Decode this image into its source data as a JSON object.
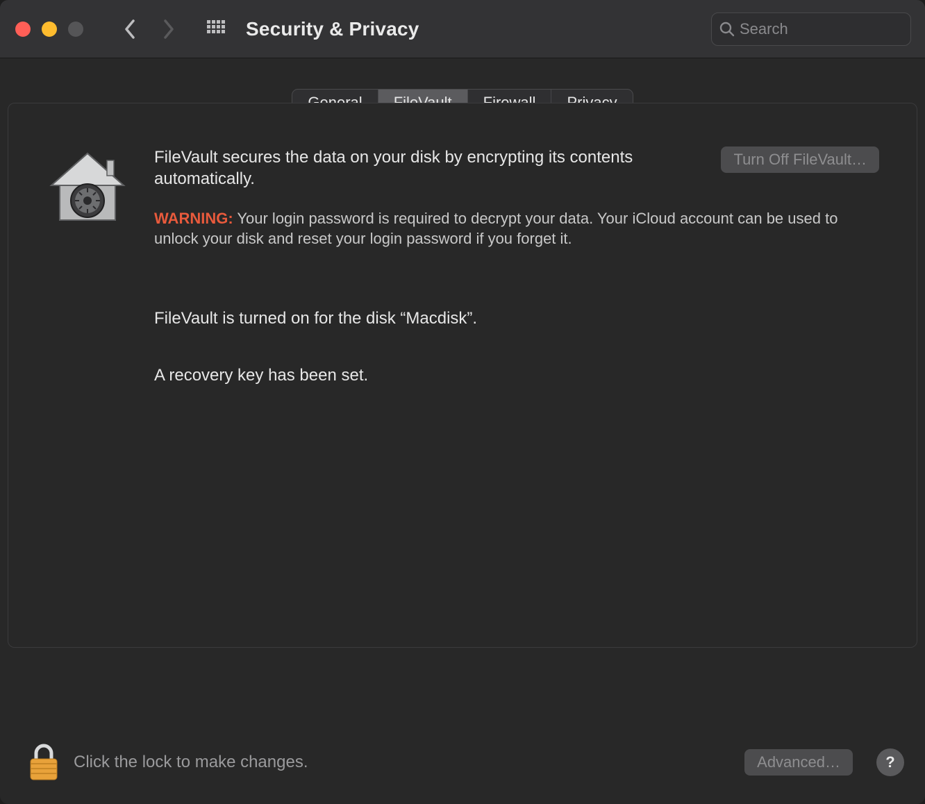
{
  "toolbar": {
    "title": "Security & Privacy",
    "search_placeholder": "Search"
  },
  "tabs": [
    {
      "label": "General"
    },
    {
      "label": "FileVault"
    },
    {
      "label": "Firewall"
    },
    {
      "label": "Privacy"
    }
  ],
  "filevault": {
    "description": "FileVault secures the data on your disk by encrypting its contents automatically.",
    "turn_off_label": "Turn Off FileVault…",
    "warning_label": "WARNING:",
    "warning_text": " Your login password is required to decrypt your data. Your iCloud account can be used to unlock your disk and reset your login password if you forget it.",
    "status_on": "FileVault is turned on for the disk “Macdisk”.",
    "recovery_status": "A recovery key has been set."
  },
  "footer": {
    "lock_text": "Click the lock to make changes.",
    "advanced_label": "Advanced…",
    "help_label": "?"
  }
}
